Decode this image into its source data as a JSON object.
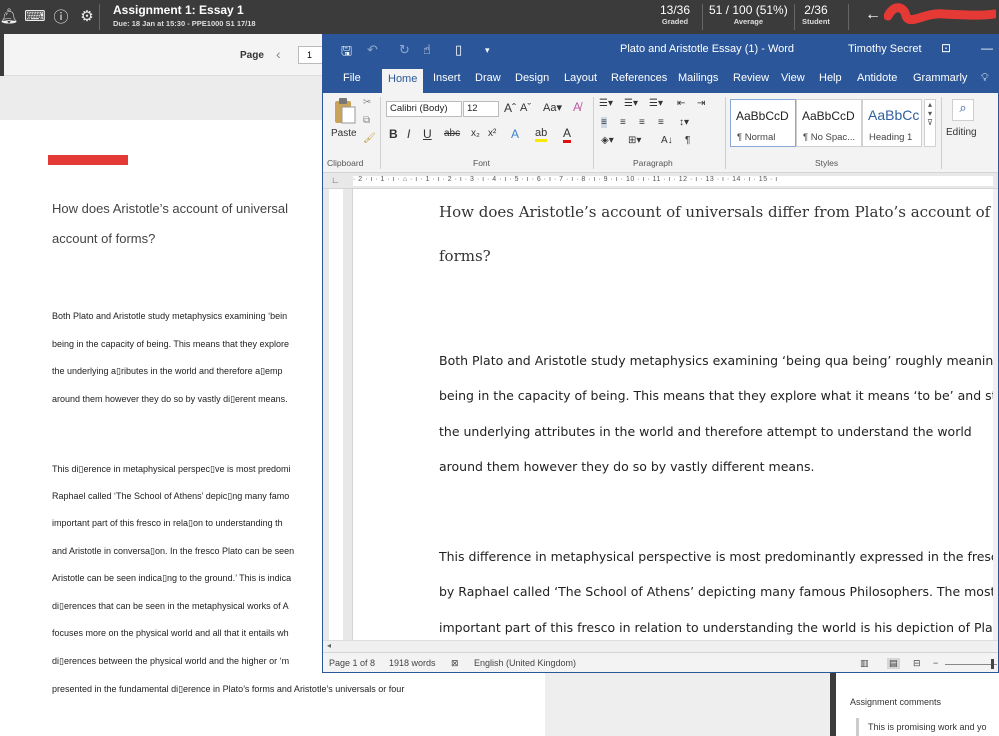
{
  "grading_bar": {
    "assignment_title": "Assignment 1: Essay 1",
    "due_text": "Due: 18 Jan at 15:30 - PPE1000 S1 17/18",
    "stats": [
      {
        "value": "13/36",
        "label": "Graded"
      },
      {
        "value": "51 / 100 (51%)",
        "label": "Average"
      },
      {
        "value": "2/36",
        "label": "Student"
      }
    ],
    "back_arrow": "←",
    "icons": [
      "bell-icon",
      "keyboard-icon",
      "help-icon",
      "gear-icon"
    ]
  },
  "viewer": {
    "page_label": "Page",
    "page_number": "1",
    "question_lines": [
      "How does Aristotle’s account of universal",
      "account of forms?"
    ],
    "body_lines": [
      "Both Plato and Aristotle study metaphysics examining ‘bein",
      "being in the capacity of being. This means that they explore",
      "the underlying a▯ributes in the world and therefore a▯emp",
      "around them however they do so by vastly di▯erent means.",
      "This di▯erence in metaphysical perspec▯ve is most predomi",
      "Raphael called ‘The School of Athens’ depic▯ng many famo",
      "important part of this fresco in rela▯on to understanding th",
      "and Aristotle in conversa▯on. In the fresco Plato can be seen",
      "Aristotle can be seen indica▯ng to the ground.’ This is indica",
      "di▯erences that can be seen in the metaphysical works of A",
      "focuses more on the physical world and all that it entails wh",
      "di▯erences between the physical world and the higher or ‘m",
      "presented in the fundamental di▯erence in Plato’s forms and Aristotle’s universals or four"
    ]
  },
  "comments": {
    "title": "Assignment comments",
    "first": "This is promising work and yo"
  },
  "word": {
    "document_title": "Plato and Aristotle Essay (1)  -  Word",
    "user_name": "Timothy Secret",
    "tabs": [
      "File",
      "Home",
      "Insert",
      "Draw",
      "Design",
      "Layout",
      "References",
      "Mailings",
      "Review",
      "View",
      "Help",
      "Antidote",
      "Grammarly"
    ],
    "active_tab": "Home",
    "ribbon": {
      "paste_label": "Paste",
      "font_name": "Calibri (Body)",
      "font_size": "12",
      "clipboard_label": "Clipboard",
      "font_label": "Font",
      "paragraph_label": "Paragraph",
      "styles_label": "Styles",
      "editing_label": "Editing",
      "styles": [
        {
          "sample": "AaBbCcD",
          "name": "¶ Normal"
        },
        {
          "sample": "AaBbCcD",
          "name": "¶ No Spac..."
        },
        {
          "sample": "AaBbCc",
          "name": "Heading 1"
        }
      ]
    },
    "ruler_text": "· 2 · ı · 1 · ı · ⌂ · ı · 1 · ı · 2 · ı · 3 · ı · 4 · ı · 5 · ı · 6 · ı · 7 · ı · 8 · ı · 9 · ı · 10 · ı · 11 · ı · 12 · ı · 13 · ı · 14 · ı · 15 · ı",
    "question_lines": [
      "How does Aristotle’s account of universals differ from Plato’s account of",
      "forms?"
    ],
    "body_lines": [
      "Both Plato and Aristotle study metaphysics examining ‘being qua being’ roughly meaning",
      "being in the capacity of being. This means that they explore what it means ‘to be’ and study",
      "the underlying attributes in the world and therefore attempt to understand the world",
      "around them however they do so by vastly different means.",
      "This difference in metaphysical perspective is most predominantly expressed in the fresco",
      "by Raphael called ‘The School of Athens’ depicting many famous Philosophers. The most",
      "important part of this fresco in relation to understanding the world is his depiction of Plato"
    ],
    "status": {
      "page": "Page 1 of 8",
      "words": "1918 words",
      "language": "English (United Kingdom)"
    }
  },
  "colors": {
    "word_blue": "#2b579a",
    "grading_dark": "#3b3b3b",
    "redaction_red": "#e53935"
  }
}
